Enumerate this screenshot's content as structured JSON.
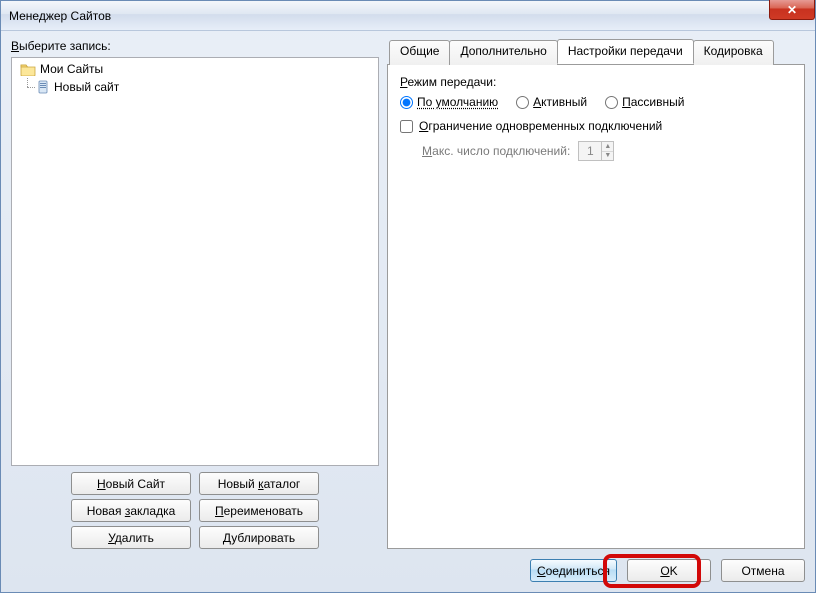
{
  "window": {
    "title": "Менеджер Сайтов"
  },
  "left": {
    "select_label_pre": "В",
    "select_label_rest": "ыберите запись:",
    "tree": {
      "root": "Мои Сайты",
      "child": "Новый сайт"
    },
    "buttons": {
      "new_site_pre": "Н",
      "new_site_rest": "овый Сайт",
      "new_folder_pre": "Новый ",
      "new_folder_u": "к",
      "new_folder_rest": "аталог",
      "new_bookmark_pre": "Новая ",
      "new_bookmark_u": "з",
      "new_bookmark_rest": "акладка",
      "rename_u": "П",
      "rename_rest": "ереименовать",
      "delete_u": "У",
      "delete_rest": "далить",
      "duplicate_u": "Д",
      "duplicate_rest": "ублировать"
    }
  },
  "tabs": {
    "general": "Общие",
    "advanced": "Дополнительно",
    "transfer": "Настройки передачи",
    "charset": "Кодировка"
  },
  "transfer": {
    "mode_label_u": "Р",
    "mode_label_rest": "ежим передачи:",
    "radio_default": "По умолчанию",
    "radio_active_u": "А",
    "radio_active_rest": "ктивный",
    "radio_passive_u": "П",
    "radio_passive_rest": "ассивный",
    "limit_u": "О",
    "limit_rest": "граничение одновременных подключений",
    "max_label_u": "М",
    "max_label_rest": "акс. число подключений:",
    "max_value": "1"
  },
  "bottom": {
    "connect_u": "С",
    "connect_rest": "оединиться",
    "ok_u": "O",
    "ok_rest": "K",
    "cancel": "Отмена"
  }
}
